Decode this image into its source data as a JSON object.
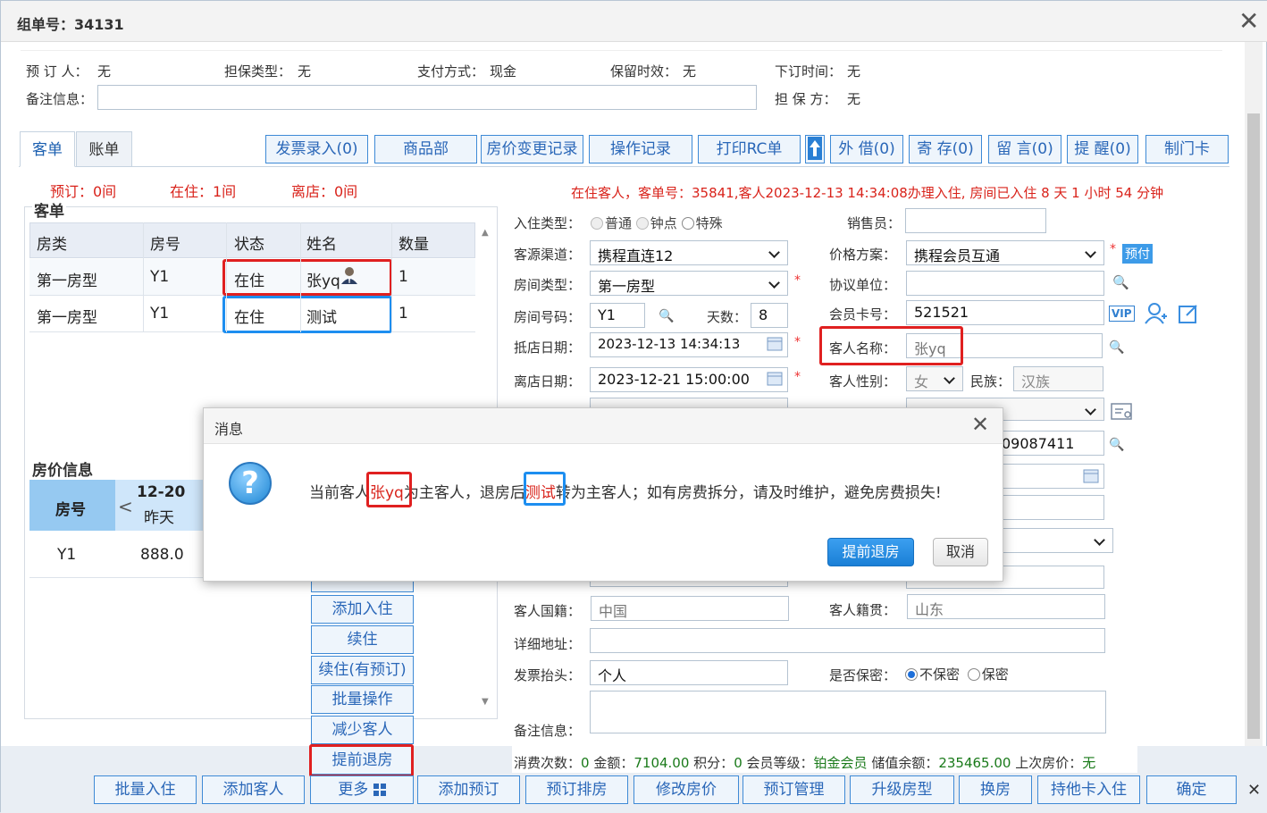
{
  "window": {
    "title": "组单号：34131"
  },
  "top_info": {
    "reserver_label": "预 订 人：",
    "reserver_value": "无",
    "guarantee_type_label": "担保类型：",
    "guarantee_type_value": "无",
    "payment_label": "支付方式：",
    "payment_value": "现金",
    "retention_label": "保留时效：",
    "retention_value": "无",
    "order_time_label": "下订时间：",
    "order_time_value": "无",
    "remark_label": "备注信息：",
    "guarantor_label": "担 保 方：",
    "guarantor_value": "无"
  },
  "tabs": {
    "order": "客单",
    "bill": "账单"
  },
  "toolbar": {
    "invoice": "发票录入(0)",
    "goods": "商品部",
    "price_change": "房价变更记录",
    "op_log": "操作记录",
    "print_rc": "打印RC单",
    "borrow": "外 借(0)",
    "deposit": "寄 存(0)",
    "message": "留 言(0)",
    "remind": "提 醒(0)",
    "make_card": "制门卡"
  },
  "summary": {
    "reserve": "预订：0间",
    "staying": "在住：1间",
    "left": "离店：0间"
  },
  "status_line": "在住客人，客单号：35841,客人2023-12-13 14:34:08办理入住, 房间已入住 8 天 1 小时 54 分钟",
  "guest_list": {
    "section_title": "客单",
    "headers": [
      "房类",
      "房号",
      "状态",
      "姓名",
      "数量"
    ],
    "rows": [
      {
        "room_type": "第一房型",
        "room_no": "Y1",
        "status": "在住",
        "name": "张yq",
        "qty": "1"
      },
      {
        "room_type": "第一房型",
        "room_no": "Y1",
        "status": "在住",
        "name": "测试",
        "qty": "1"
      }
    ]
  },
  "price_info": {
    "section_title": "房价信息",
    "room_header": "房号",
    "date": "12-20",
    "date_sub": "昨天",
    "prev": "<",
    "room": "Y1",
    "price": "888.0"
  },
  "side_buttons": [
    "添加入住",
    "续住",
    "续住(有预订)",
    "批量操作",
    "减少客人",
    "提前退房"
  ],
  "form": {
    "checkin_type_label": "入住类型：",
    "type_normal": "普通",
    "type_hourly": "钟点",
    "type_special": "特殊",
    "salesman_label": "销售员：",
    "channel_label": "客源渠道：",
    "channel_value": "携程直连12",
    "price_plan_label": "价格方案：",
    "price_plan_value": "携程会员互通",
    "prepay_badge": "预付",
    "room_type_label": "房间类型：",
    "room_type_value": "第一房型",
    "agreement_label": "协议单位：",
    "room_no_label": "房间号码：",
    "room_no_value": "Y1",
    "days_label": "天数：",
    "days_value": "8",
    "member_card_label": "会员卡号：",
    "member_card_value": "521521",
    "vip_badge": "VIP",
    "arrive_label": "抵店日期：",
    "arrive_value": "2023-12-13 14:34:13",
    "guest_name_label": "客人名称：",
    "guest_name_value": "张yq",
    "depart_label": "离店日期：",
    "depart_value": "2023-12-21 15:00:00",
    "gender_label": "客人性别：",
    "gender_value": "女",
    "ethnic_label": "民族：",
    "ethnic_value": "汉族",
    "id_partial": "09087411",
    "nationality_label": "客人国籍：",
    "nationality_value": "中国",
    "native_label": "客人籍贯：",
    "native_value": "山东",
    "address_label": "详细地址：",
    "invoice_title_label": "发票抬头：",
    "invoice_title_value": "个人",
    "secret_label": "是否保密：",
    "secret_no": "不保密",
    "secret_yes": "保密",
    "remark_label": "备注信息："
  },
  "footer_stats": {
    "consume_label": "消费次数：",
    "consume_value": "0",
    "amount_label": "金额：",
    "amount_value": "7104.00",
    "points_label": "积分：",
    "points_value": "0",
    "level_label": "会员等级：",
    "level_value": "铂金会员",
    "balance_label": "储值余额：",
    "balance_value": "235465.00",
    "last_price_label": "上次房价：",
    "last_price_value": "无"
  },
  "bottom_buttons": {
    "batch_checkin": "批量入住",
    "add_guest": "添加客人",
    "more": "更多",
    "add_reserve": "添加预订",
    "reserve_arrange": "预订排房",
    "modify_price": "修改房价",
    "reserve_manage": "预订管理",
    "upgrade": "升级房型",
    "change_room": "换房",
    "card_checkin": "持他卡入住",
    "confirm": "确定"
  },
  "dialog": {
    "title": "消息",
    "msg_pre": "当前客人",
    "msg_name1": "张yq",
    "msg_mid": "为主客人，退房后",
    "msg_name2": "测试",
    "msg_post": "转为主客人；如有房费拆分，请及时维护，避免房费损失!",
    "ok": "提前退房",
    "cancel": "取消"
  }
}
